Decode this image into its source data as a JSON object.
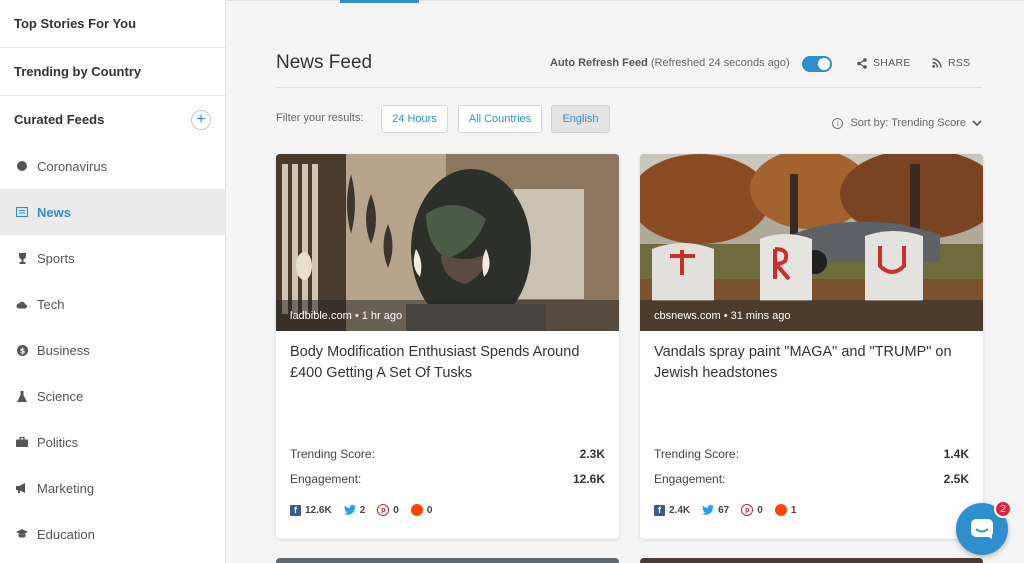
{
  "sidebar": {
    "top_stories": "Top Stories For You",
    "trending_country": "Trending by Country",
    "curated_feeds": "Curated Feeds",
    "items": [
      {
        "label": "Coronavirus",
        "icon": "circle-icon"
      },
      {
        "label": "News",
        "icon": "newspaper-icon"
      },
      {
        "label": "Sports",
        "icon": "trophy-icon"
      },
      {
        "label": "Tech",
        "icon": "cloud-icon"
      },
      {
        "label": "Business",
        "icon": "dollar-icon"
      },
      {
        "label": "Science",
        "icon": "flask-icon"
      },
      {
        "label": "Politics",
        "icon": "briefcase-icon"
      },
      {
        "label": "Marketing",
        "icon": "megaphone-icon"
      },
      {
        "label": "Education",
        "icon": "graduation-cap-icon"
      }
    ]
  },
  "header": {
    "title": "News Feed",
    "auto_refresh_label": "Auto Refresh Feed",
    "refresh_status": "(Refreshed 24 seconds ago)",
    "share_label": "SHARE",
    "rss_label": "RSS"
  },
  "filters": {
    "label": "Filter your results:",
    "chips": [
      "24 Hours",
      "All Countries",
      "English"
    ],
    "sort_label": "Sort by: Trending Score"
  },
  "cards": [
    {
      "source": "ladbible.com • 1 hr ago",
      "title": "Body Modification Enthusiast Spends Around £400 Getting A Set Of Tusks",
      "trending_label": "Trending Score:",
      "trending_value": "2.3K",
      "engagement_label": "Engagement:",
      "engagement_value": "12.6K",
      "facebook": "12.6K",
      "twitter": "2",
      "pinterest": "0",
      "reddit": "0"
    },
    {
      "source": "cbsnews.com • 31 mins ago",
      "title": "Vandals spray paint \"MAGA\" and \"TRUMP\" on Jewish headstones",
      "trending_label": "Trending Score:",
      "trending_value": "1.4K",
      "engagement_label": "Engagement:",
      "engagement_value": "2.5K",
      "facebook": "2.4K",
      "twitter": "67",
      "pinterest": "0",
      "reddit": "1"
    }
  ],
  "chat": {
    "badge": "2"
  },
  "colors": {
    "accent": "#2f8fce",
    "badge": "#e0243c"
  }
}
